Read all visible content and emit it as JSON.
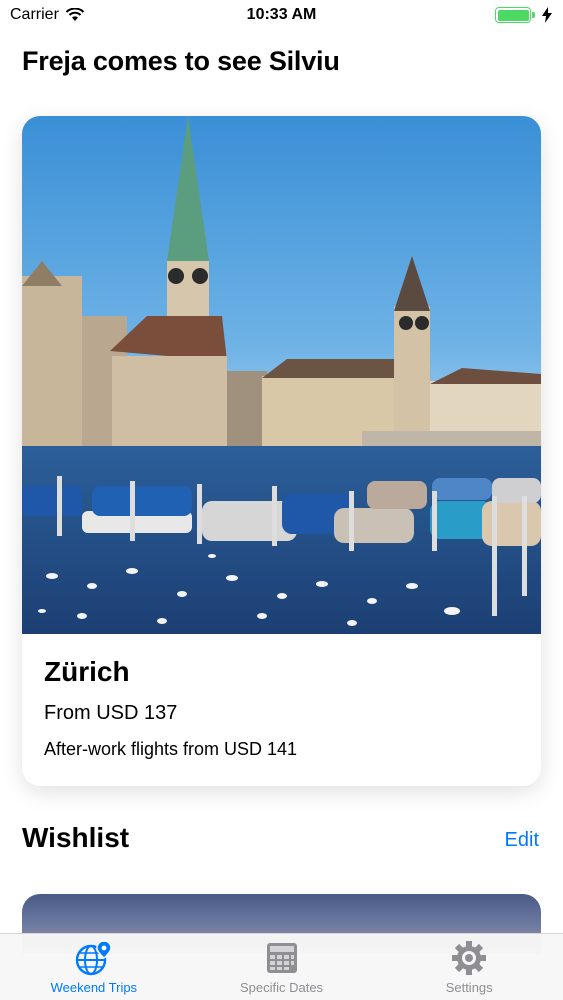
{
  "status_bar": {
    "carrier": "Carrier",
    "time": "10:33 AM",
    "battery_level": 1.0
  },
  "page": {
    "heading": "Freja comes to see Silviu"
  },
  "featured_card": {
    "city": "Zürich",
    "price": "From USD 137",
    "subtitle": "After-work flights from USD 141"
  },
  "wishlist": {
    "title": "Wishlist",
    "edit_label": "Edit"
  },
  "tab_bar": {
    "tabs": [
      {
        "label": "Weekend Trips",
        "icon": "globe-pin-icon",
        "active": true
      },
      {
        "label": "Specific Dates",
        "icon": "calendar-icon",
        "active": false
      },
      {
        "label": "Settings",
        "icon": "gear-icon",
        "active": false
      }
    ]
  },
  "colors": {
    "accent": "#007aff",
    "inactive": "#8e8e93",
    "battery": "#4cd964"
  }
}
